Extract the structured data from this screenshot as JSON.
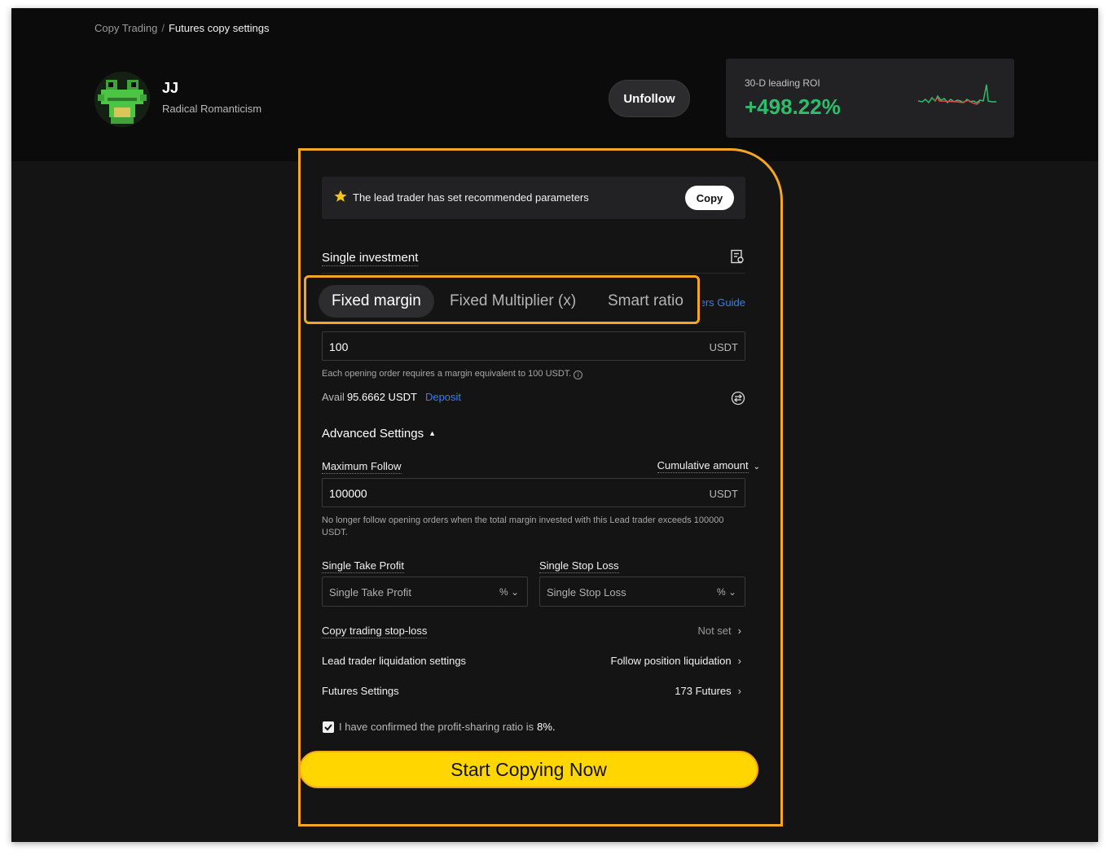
{
  "breadcrumb": {
    "parent": "Copy Trading",
    "separator": "/",
    "current": "Futures copy settings"
  },
  "trader": {
    "name": "JJ",
    "subtitle": "Radical Romanticism"
  },
  "actions": {
    "unfollow_label": "Unfollow"
  },
  "roi": {
    "label": "30-D leading ROI",
    "value": "+498.22%",
    "color": "#2fbd6b"
  },
  "recommendation": {
    "text": "The lead trader has set recommended parameters",
    "copy_label": "Copy"
  },
  "single_investment": {
    "title": "Single investment",
    "tabs": [
      {
        "label": "Fixed margin",
        "active": true
      },
      {
        "label": "Fixed Multiplier (x)",
        "active": false
      },
      {
        "label": "Smart ratio",
        "active": false
      }
    ],
    "guide_link": "ers Guide",
    "amount_value": "100",
    "amount_unit": "USDT",
    "hint": "Each opening order requires a margin equivalent to 100 USDT.",
    "avail_label": "Avail",
    "avail_value": "95.6662 USDT",
    "deposit_label": "Deposit"
  },
  "advanced": {
    "title": "Advanced Settings",
    "max_follow_label": "Maximum Follow",
    "cumulative_label": "Cumulative amount",
    "max_follow_value": "100000",
    "max_follow_unit": "USDT",
    "max_follow_hint": "No longer follow opening orders when the total margin invested with this Lead trader exceeds 100000 USDT.",
    "take_profit_label": "Single Take Profit",
    "take_profit_placeholder": "Single Take Profit",
    "stop_loss_label": "Single Stop Loss",
    "stop_loss_placeholder": "Single Stop Loss",
    "percent_unit": "%"
  },
  "rows": {
    "copy_stop_loss_label": "Copy trading stop-loss",
    "copy_stop_loss_value": "Not set",
    "liquidation_label": "Lead trader liquidation settings",
    "liquidation_value": "Follow position liquidation",
    "futures_label": "Futures Settings",
    "futures_value": "173 Futures"
  },
  "confirm": {
    "text": "I have confirmed the profit-sharing ratio is",
    "ratio": "8%."
  },
  "start_label": "Start Copying Now",
  "colors": {
    "accent": "#ffd600",
    "highlight": "#f5a623",
    "link": "#3a7cf2",
    "background": "#141414"
  }
}
